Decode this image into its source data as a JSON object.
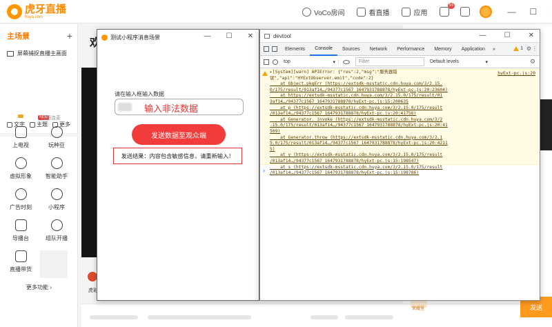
{
  "app": {
    "logo_cn": "虎牙直播",
    "logo_en": "huya.com",
    "top_actions": [
      "VoCo房间",
      "看直播",
      "应用"
    ],
    "msg_badge": "55",
    "win_min": "—",
    "win_max": "☐",
    "win_close": "✕"
  },
  "sidebar": {
    "title": "主场景",
    "add": "+",
    "scene_item": "屏幕捕捉直播主画面",
    "tools": [
      "文字",
      "主题",
      "更多"
    ],
    "new_tag": "NEW",
    "section_label": "视频连麦",
    "grid": [
      "上电视",
      "玩种豆",
      "虚拟形象",
      "智能助手",
      "广告时刻",
      "小程序",
      "导播台",
      "组队开播",
      "直播带货"
    ],
    "more": "更多功能 ›"
  },
  "content": {
    "title": "欢",
    "name": "虎彩"
  },
  "right": {
    "send": "发送",
    "gift_label": "荣耀里"
  },
  "mini": {
    "title": "测试小程序消息场景",
    "ctrl_min": "—",
    "ctrl_max": "☐",
    "ctrl_close": "✕",
    "input_label": "请在输入框输入数据",
    "input_value": "输入非法数据",
    "send_button": "发送数据至观众端",
    "result": "发送结果：内容包含敏感信息，请重新输入！"
  },
  "devtool": {
    "title": "devtool",
    "ctrl_min": "—",
    "ctrl_max": "☐",
    "ctrl_close": "✕",
    "tabs": [
      "Elements",
      "Console",
      "Sources",
      "Network",
      "Performance",
      "Memory",
      "Application"
    ],
    "active_tab": "Console",
    "more_tabs": "»",
    "warn_count": "1",
    "context": "top",
    "filter_placeholder": "Filter",
    "levels": "Default levels",
    "prompt": "›",
    "warning": {
      "source": "hyExt-pc.js:20",
      "lines": [
        "▸[System][warn] APIError: {\"res\":2,\"msg\":\"服务器错",
        "误\",\"api\":\"HYExtObserver.emit\",\"code\":2}",
        "    at Object.pkgErr (https://extsdk-msstatic.cdn.huya.com/3/2.15.0/175/result/013af14…/94377c1567_1647931788878/hyExt-pc.js:20:23604)",
        "    at https://extsdk-msstatic.cdn.huya.com/3/2.15.0/175/result/013af14…/94377c1567_1647931788878/hyExt-pc.js:15:200635",
        "    at p (https://extsdk-msstatic.cdn.huya.com/3/2.15.0/175/result/013af14…/94377c1567_1647931788878/hyExt-pc.js:20:41756)",
        "    at Generator._invoke (https://extsdk-msstatic.cdn.huya.com/3/2.15.0/175/result/013af14…/94377c1567_1647931788878/hyExt-pc.js:20:41509)",
        "    at Generator.throw (https://extsdk-msstatic.cdn.huya.com/3/2.15.0/175/result/013af14…/94377c1567_1647931788878/hyExt-pc.js:20:42115)",
        "    at y (https://extsdk-msstatic.cdn.huya.com/3/2.15.0/175/result/013af14…/94377c1567_1647931788878/hyExt-pc.js:15:198547)",
        "    at s (https://extsdk-msstatic.cdn.huya.com/3/2.15.0/175/result/013af14…/94377c1567_1647931788878/hyExt-pc.js:15:198786)"
      ]
    }
  }
}
